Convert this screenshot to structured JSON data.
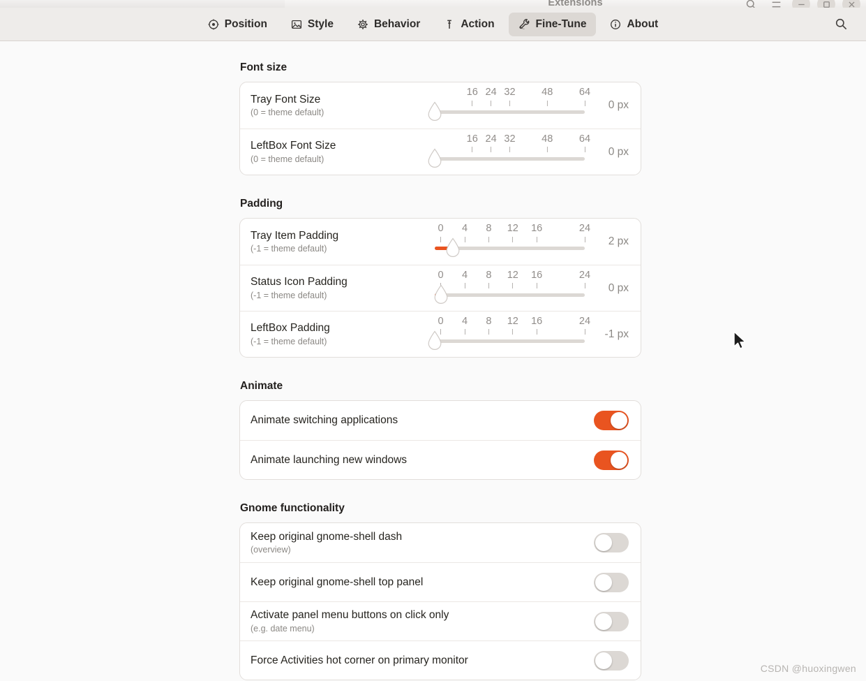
{
  "window": {
    "title": "Extensions",
    "controls": [
      {
        "name": "search-button",
        "glyph": "search"
      },
      {
        "name": "menu-button",
        "glyph": "menu"
      },
      {
        "name": "minimize-button",
        "glyph": "minimize"
      },
      {
        "name": "maximize-button",
        "glyph": "maximize"
      },
      {
        "name": "close-button",
        "glyph": "close"
      }
    ]
  },
  "header": {
    "tabs": [
      {
        "label": "Position",
        "icon": "target-icon",
        "active": false
      },
      {
        "label": "Style",
        "icon": "image-icon",
        "active": false
      },
      {
        "label": "Behavior",
        "icon": "gear-icon",
        "active": false
      },
      {
        "label": "Action",
        "icon": "pin-icon",
        "active": false
      },
      {
        "label": "Fine-Tune",
        "icon": "wrench-icon",
        "active": true
      },
      {
        "label": "About",
        "icon": "info-icon",
        "active": false
      }
    ],
    "search_icon": "search-icon"
  },
  "groups": [
    {
      "title": "Font size",
      "rows": [
        {
          "type": "slider",
          "title": "Tray Font Size",
          "subtitle": "(0 = theme default)",
          "value": 0,
          "value_label": "0 px",
          "min": 0,
          "max": 64,
          "marks": [
            {
              "label": "16",
              "value": 16
            },
            {
              "label": "24",
              "value": 24
            },
            {
              "label": "32",
              "value": 32
            },
            {
              "label": "48",
              "value": 48
            },
            {
              "label": "64",
              "value": 64
            }
          ]
        },
        {
          "type": "slider",
          "title": "LeftBox Font Size",
          "subtitle": "(0 = theme default)",
          "value": 0,
          "value_label": "0 px",
          "min": 0,
          "max": 64,
          "marks": [
            {
              "label": "16",
              "value": 16
            },
            {
              "label": "24",
              "value": 24
            },
            {
              "label": "32",
              "value": 32
            },
            {
              "label": "48",
              "value": 48
            },
            {
              "label": "64",
              "value": 64
            }
          ]
        }
      ]
    },
    {
      "title": "Padding",
      "rows": [
        {
          "type": "slider",
          "title": "Tray Item Padding",
          "subtitle": "(-1 = theme default)",
          "value": 2,
          "value_label": "2 px",
          "min": -1,
          "max": 24,
          "marks": [
            {
              "label": "0",
              "value": 0
            },
            {
              "label": "4",
              "value": 4
            },
            {
              "label": "8",
              "value": 8
            },
            {
              "label": "12",
              "value": 12
            },
            {
              "label": "16",
              "value": 16
            },
            {
              "label": "24",
              "value": 24
            }
          ]
        },
        {
          "type": "slider",
          "title": "Status Icon Padding",
          "subtitle": "(-1 = theme default)",
          "value": 0,
          "value_label": "0 px",
          "min": -1,
          "max": 24,
          "marks": [
            {
              "label": "0",
              "value": 0
            },
            {
              "label": "4",
              "value": 4
            },
            {
              "label": "8",
              "value": 8
            },
            {
              "label": "12",
              "value": 12
            },
            {
              "label": "16",
              "value": 16
            },
            {
              "label": "24",
              "value": 24
            }
          ]
        },
        {
          "type": "slider",
          "title": "LeftBox Padding",
          "subtitle": "(-1 = theme default)",
          "value": -1,
          "value_label": "-1 px",
          "min": -1,
          "max": 24,
          "marks": [
            {
              "label": "0",
              "value": 0
            },
            {
              "label": "4",
              "value": 4
            },
            {
              "label": "8",
              "value": 8
            },
            {
              "label": "12",
              "value": 12
            },
            {
              "label": "16",
              "value": 16
            },
            {
              "label": "24",
              "value": 24
            }
          ]
        }
      ]
    },
    {
      "title": "Animate",
      "rows": [
        {
          "type": "switch",
          "title": "Animate switching applications",
          "subtitle": "",
          "on": true
        },
        {
          "type": "switch",
          "title": "Animate launching new windows",
          "subtitle": "",
          "on": true
        }
      ]
    },
    {
      "title": "Gnome functionality",
      "rows": [
        {
          "type": "switch",
          "title": "Keep original gnome-shell dash",
          "subtitle": "(overview)",
          "on": false
        },
        {
          "type": "switch",
          "title": "Keep original gnome-shell top panel",
          "subtitle": "",
          "on": false
        },
        {
          "type": "switch",
          "title": "Activate panel menu buttons on click only",
          "subtitle": "(e.g. date menu)",
          "on": false
        },
        {
          "type": "switch",
          "title": "Force Activities hot corner on primary monitor",
          "subtitle": "",
          "on": false
        }
      ]
    }
  ],
  "watermark": "CSDN @huoxingwen",
  "colors": {
    "accent": "#e95420",
    "page_bg": "#fafafa",
    "card_bg": "#ffffff",
    "header_bg": "#eeecea"
  }
}
